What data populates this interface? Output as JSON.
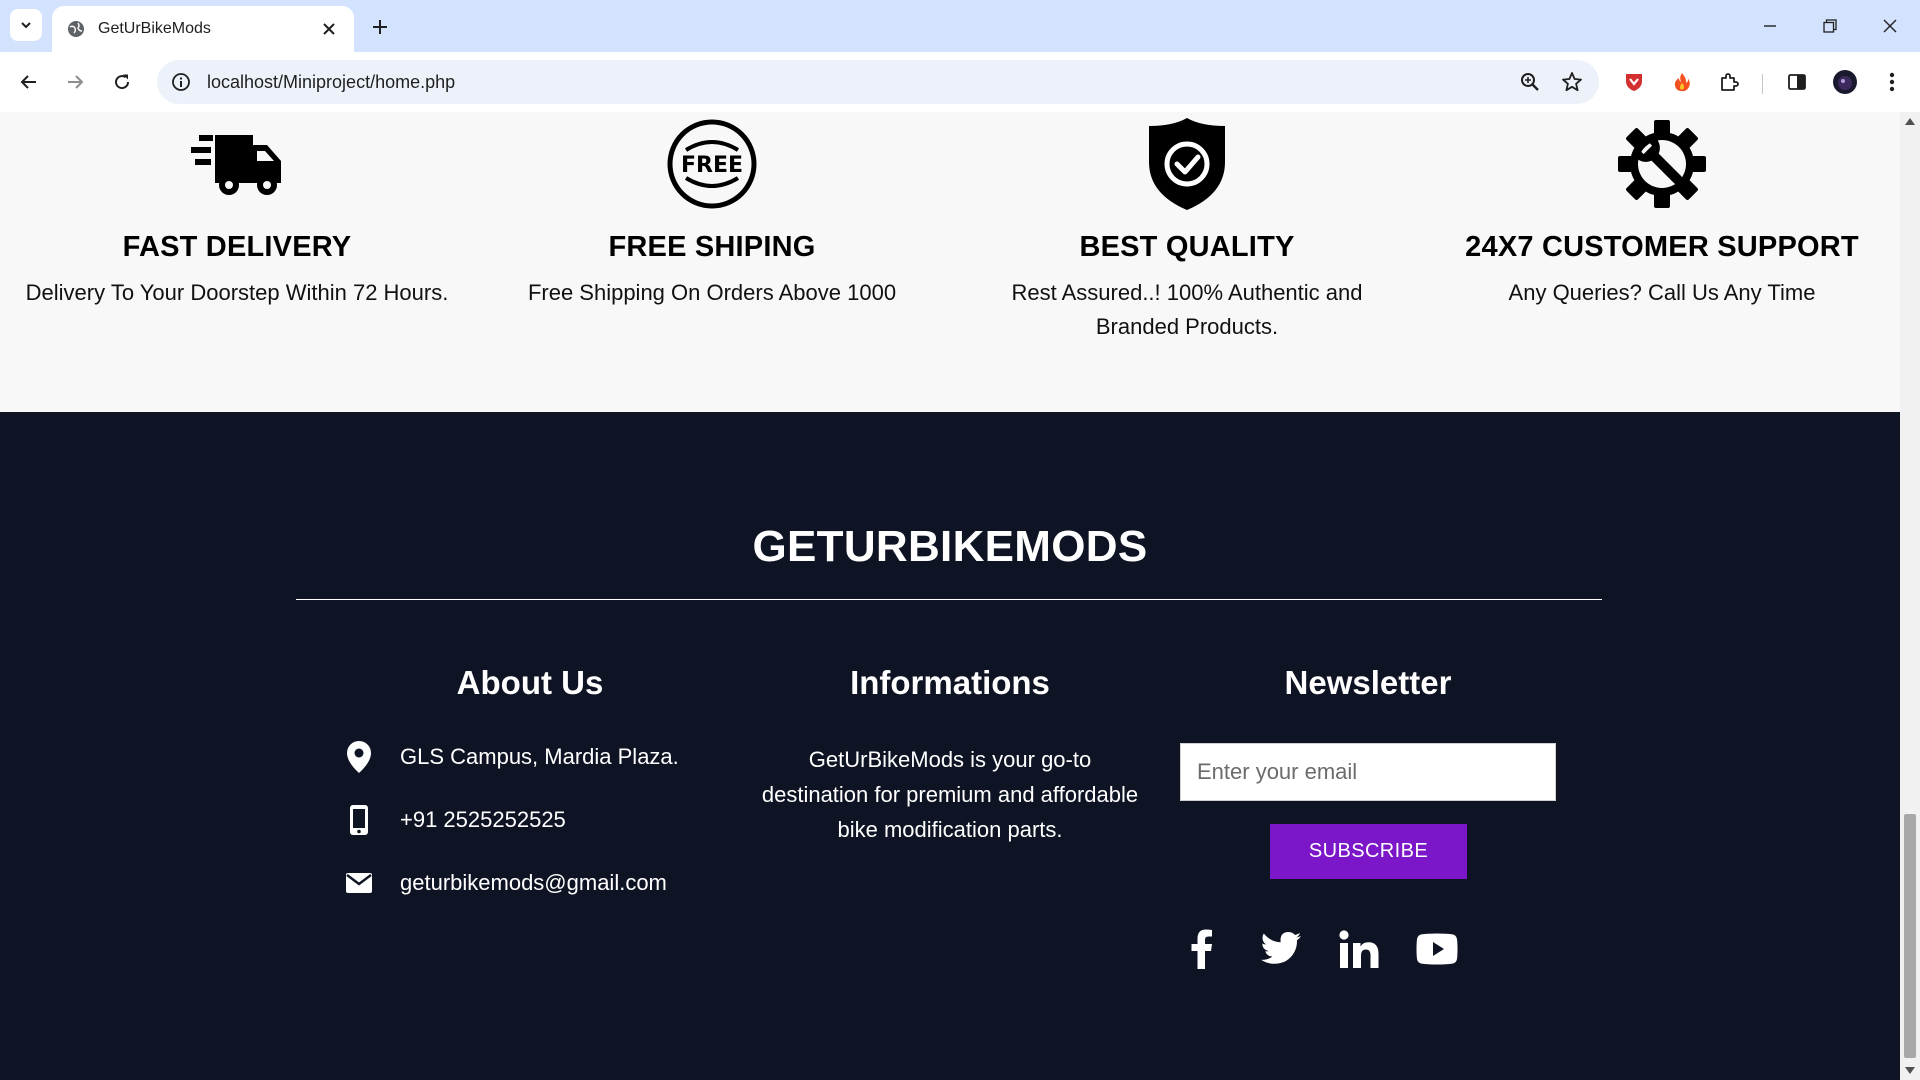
{
  "browser": {
    "tab_title": "GetUrBikeMods",
    "url": "localhost/Miniproject/home.php"
  },
  "features": [
    {
      "icon": "delivery-truck-icon",
      "title": "FAST DELIVERY",
      "description": "Delivery To Your Doorstep Within 72 Hours."
    },
    {
      "icon": "free-badge-icon",
      "title": "FREE SHIPING",
      "description": "Free Shipping On Orders Above 1000"
    },
    {
      "icon": "shield-check-icon",
      "title": "BEST QUALITY",
      "description": "Rest Assured..! 100% Authentic and Branded Products."
    },
    {
      "icon": "gear-wrench-icon",
      "title": "24X7 CUSTOMER SUPPORT",
      "description": "Any Queries? Call Us Any Time"
    }
  ],
  "footer": {
    "brand": "GETURBIKEMODS",
    "about": {
      "title": "About Us",
      "address": "GLS Campus, Mardia Plaza.",
      "phone": "+91 2525252525",
      "email": "geturbikemods@gmail.com"
    },
    "informations": {
      "title": "Informations",
      "text": "GetUrBikeMods is your go-to destination for premium and affordable bike modification parts."
    },
    "newsletter": {
      "title": "Newsletter",
      "placeholder": "Enter your email",
      "button": "SUBSCRIBE"
    },
    "social": [
      "facebook-icon",
      "twitter-icon",
      "linkedin-icon",
      "youtube-icon"
    ]
  },
  "colors": {
    "footer_bg": "#0f1424",
    "subscribe_bg": "#7b16c9",
    "features_bg": "#f8f8f8",
    "tabbar_bg": "#d3e3fd"
  }
}
